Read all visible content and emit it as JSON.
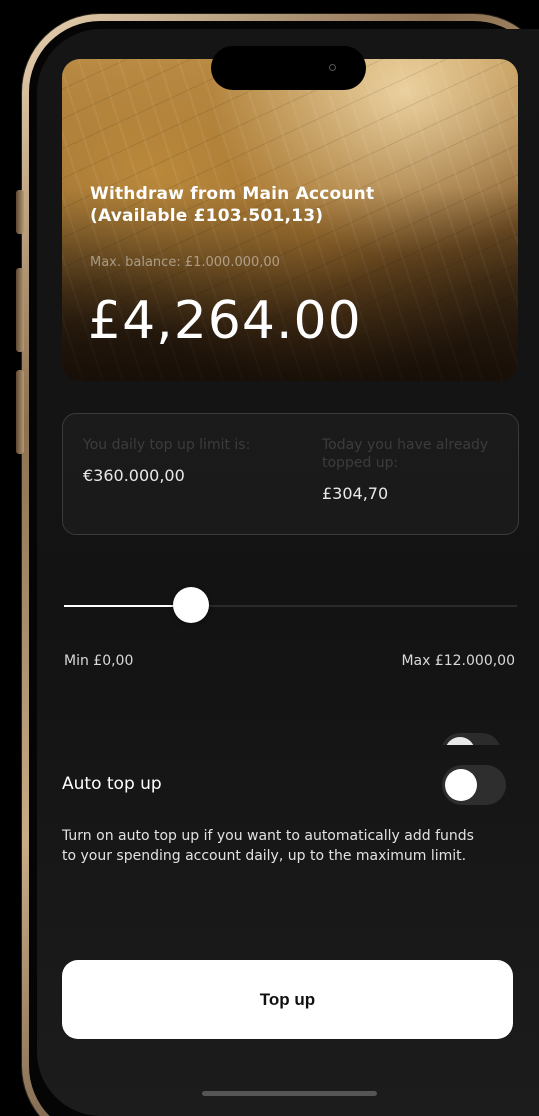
{
  "hero": {
    "title": "Withdraw from Main Account (Available £103.501,13)",
    "max_balance": "Max. balance: £1.000.000,00",
    "amount": "£4,264.00"
  },
  "limits": {
    "daily_limit_label": "You daily top up limit is:",
    "daily_limit_value": "€360.000,00",
    "topped_up_label": "Today you have already topped up:",
    "topped_up_value": "£304,70"
  },
  "slider": {
    "min_label": "Min £0,00",
    "max_label": "Max £12.000,00",
    "fraction": 0.28
  },
  "auto_top_up": {
    "title": "Auto top up",
    "enabled": false,
    "description": "Turn on auto top up if you want to automatically add funds to your spending account daily, up to the maximum limit."
  },
  "actions": {
    "top_up_label": "Top up"
  },
  "colors": {
    "background": "#131313",
    "accent": "#ffffff",
    "frame": "#c8ac86"
  }
}
